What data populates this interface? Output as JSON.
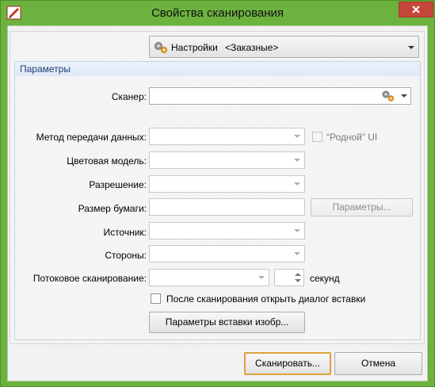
{
  "window": {
    "title": "Свойства сканирования",
    "colors": {
      "frame": "#6cb23f",
      "close": "#c7463b",
      "group_title": "#1e3e73"
    },
    "icons": {
      "app": "pdf-app-icon",
      "close": "close-icon"
    }
  },
  "presets": {
    "label": "Настройки",
    "value": "<Заказные>",
    "icon": "gear-icon"
  },
  "params": {
    "group_title": "Параметры",
    "scanner_label": "Сканер:",
    "scanner_value": "",
    "transfer_label": "Метод передачи данных:",
    "native_ui_label": "“Родной” UI",
    "color_model_label": "Цветовая модель:",
    "resolution_label": "Разрешение:",
    "paper_size_label": "Размер бумаги:",
    "paper_params_button": "Параметры...",
    "source_label": "Источник:",
    "sides_label": "Стороны:",
    "stream_label": "Потоковое сканирование:",
    "seconds_label": "секунд",
    "after_scan_label": "После сканирования открыть диалог вставки",
    "insert_params_button": "Параметры вставки изобр..."
  },
  "footer": {
    "scan_button": "Сканировать...",
    "cancel_button": "Отмена"
  }
}
